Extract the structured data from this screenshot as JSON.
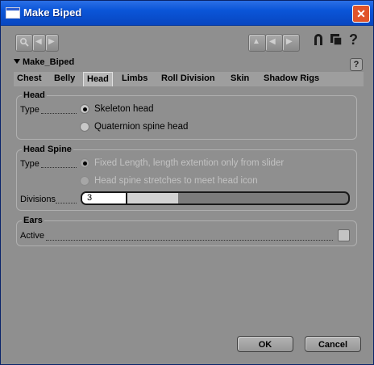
{
  "window": {
    "title": "Make Biped",
    "close_glyph": "✕"
  },
  "node": {
    "name": "Make_Biped",
    "help_glyph": "?"
  },
  "toolbar": {
    "help_glyph": "?"
  },
  "tabs": [
    {
      "label": "Chest"
    },
    {
      "label": "Belly"
    },
    {
      "label": "Head",
      "active": true
    },
    {
      "label": "Limbs"
    },
    {
      "label": "Roll Division"
    },
    {
      "label": "Skin"
    },
    {
      "label": "Shadow Rigs"
    }
  ],
  "head": {
    "title": "Head",
    "type_label": "Type",
    "options": [
      {
        "label": "Skeleton head",
        "selected": true
      },
      {
        "label": "Quaternion spine head",
        "selected": false
      }
    ]
  },
  "head_spine": {
    "title": "Head Spine",
    "type_label": "Type",
    "options": [
      {
        "label": "Fixed Length, length extention only from slider",
        "selected": true,
        "disabled": true
      },
      {
        "label": "Head spine stretches to meet head icon",
        "selected": false,
        "disabled": true
      }
    ],
    "divisions_label": "Divisions",
    "divisions_value": "3",
    "divisions_fraction": 0.36
  },
  "ears": {
    "title": "Ears",
    "active_label": "Active",
    "active_checked": false
  },
  "buttons": {
    "ok": "OK",
    "cancel": "Cancel"
  },
  "colors": {
    "titlebar": "#0a55d8",
    "panel": "#8f8f8f",
    "tab_active": "#b7b7b7"
  }
}
